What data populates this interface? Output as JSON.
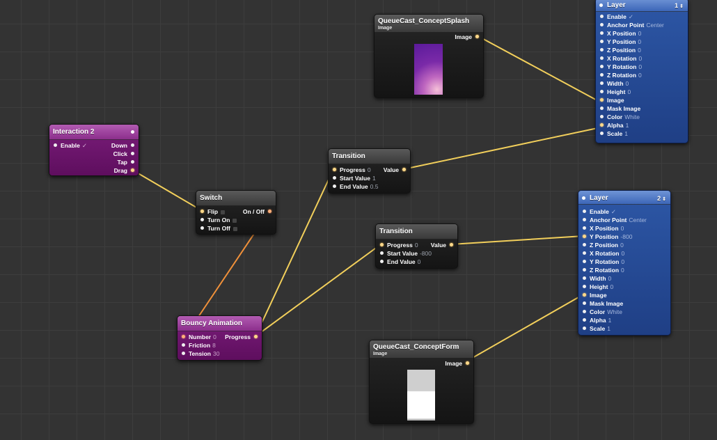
{
  "nodes": {
    "splash": {
      "title": "QueueCast_ConceptSplash",
      "subtitle": "Image",
      "output": "Image"
    },
    "form": {
      "title": "QueueCast_ConceptForm",
      "subtitle": "Image",
      "output": "Image"
    },
    "interaction": {
      "title": "Interaction 2",
      "input": "Enable",
      "input_check": "✓",
      "outputs": [
        "Down",
        "Click",
        "Tap",
        "Drag"
      ]
    },
    "switch": {
      "title": "Switch",
      "inputs": [
        "Flip",
        "Turn On",
        "Turn Off"
      ],
      "output": "On / Off"
    },
    "bouncy": {
      "title": "Bouncy Animation",
      "inputs": [
        {
          "label": "Number",
          "value": "0"
        },
        {
          "label": "Friction",
          "value": "8"
        },
        {
          "label": "Tension",
          "value": "30"
        }
      ],
      "output": "Progress"
    },
    "transition1": {
      "title": "Transition",
      "inputs": [
        {
          "label": "Progress",
          "value": "0"
        },
        {
          "label": "Start Value",
          "value": "1"
        },
        {
          "label": "End Value",
          "value": "0.5"
        }
      ],
      "output": "Value"
    },
    "transition2": {
      "title": "Transition",
      "inputs": [
        {
          "label": "Progress",
          "value": "0"
        },
        {
          "label": "Start Value",
          "value": "-800"
        },
        {
          "label": "End Value",
          "value": "0"
        }
      ],
      "output": "Value"
    },
    "layer1": {
      "title": "Layer",
      "count": "1",
      "count_arrows": "⇕",
      "inputs": [
        {
          "label": "Enable",
          "value": "✓"
        },
        {
          "label": "Anchor Point",
          "value": "Center"
        },
        {
          "label": "X Position",
          "value": "0"
        },
        {
          "label": "Y Position",
          "value": "0"
        },
        {
          "label": "Z Position",
          "value": "0"
        },
        {
          "label": "X Rotation",
          "value": "0"
        },
        {
          "label": "Y Rotation",
          "value": "0"
        },
        {
          "label": "Z Rotation",
          "value": "0"
        },
        {
          "label": "Width",
          "value": "0"
        },
        {
          "label": "Height",
          "value": "0"
        },
        {
          "label": "Image",
          "value": ""
        },
        {
          "label": "Mask Image",
          "value": ""
        },
        {
          "label": "Color",
          "value": "White"
        },
        {
          "label": "Alpha",
          "value": "1"
        },
        {
          "label": "Scale",
          "value": "1"
        }
      ]
    },
    "layer2": {
      "title": "Layer",
      "count": "2",
      "count_arrows": "⇕",
      "inputs": [
        {
          "label": "Enable",
          "value": "✓"
        },
        {
          "label": "Anchor Point",
          "value": "Center"
        },
        {
          "label": "X Position",
          "value": "0"
        },
        {
          "label": "Y Position",
          "value": "-800"
        },
        {
          "label": "Z Position",
          "value": "0"
        },
        {
          "label": "X Rotation",
          "value": "0"
        },
        {
          "label": "Y Rotation",
          "value": "0"
        },
        {
          "label": "Z Rotation",
          "value": "0"
        },
        {
          "label": "Width",
          "value": "0"
        },
        {
          "label": "Height",
          "value": "0"
        },
        {
          "label": "Image",
          "value": ""
        },
        {
          "label": "Mask Image",
          "value": ""
        },
        {
          "label": "Color",
          "value": "White"
        },
        {
          "label": "Alpha",
          "value": "1"
        },
        {
          "label": "Scale",
          "value": "1"
        }
      ]
    }
  },
  "colors": {
    "wire": "#f2cf5b",
    "wire_pulse": "#f0913a",
    "canvas": "#333333",
    "patch_purple": "#7a1d7a",
    "layer_blue": "#2d57a6"
  }
}
